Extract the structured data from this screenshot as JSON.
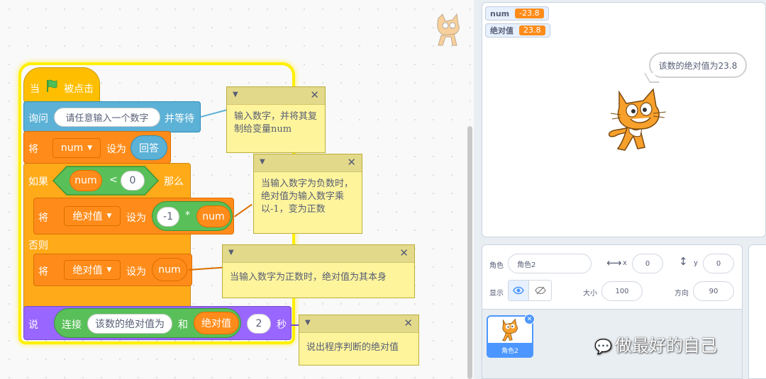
{
  "blocks": {
    "when_flag": {
      "when": "当",
      "clicked": "被点击"
    },
    "ask": {
      "ask": "询问",
      "prompt": "请任意输入一个数字",
      "wait": "并等待"
    },
    "set_num": {
      "set": "将",
      "var": "num",
      "to": "设为",
      "value": "回答"
    },
    "if": {
      "if": "如果",
      "var": "num",
      "op": "<",
      "value": "0",
      "then": "那么"
    },
    "set_abs_neg": {
      "set": "将",
      "var": "绝对值",
      "to": "设为",
      "left": "-1",
      "op": "*",
      "right": "num"
    },
    "else": {
      "label": "否则"
    },
    "set_abs_pos": {
      "set": "将",
      "var": "绝对值",
      "to": "设为",
      "value": "num"
    },
    "say": {
      "say": "说",
      "join": "连接",
      "text": "该数的绝对值为",
      "and": "和",
      "var": "绝对值",
      "secs": "2",
      "unit": "秒"
    }
  },
  "comments": [
    {
      "text": "输入数字，并将其复制给变量num"
    },
    {
      "text": "当输入数字为负数时，绝对值为输入数字乘以-1，变为正数"
    },
    {
      "text": "当输入数字为正数时，绝对值为其本身"
    },
    {
      "text": "说出程序判断的绝对值"
    }
  ],
  "stage": {
    "monitors": [
      {
        "label": "num",
        "value": "-23.8"
      },
      {
        "label": "绝对值",
        "value": "23.8"
      }
    ],
    "speech": "该数的绝对值为23.8"
  },
  "sprite_info": {
    "sprite_label": "角色",
    "sprite_name": "角色2",
    "x_label": "x",
    "x": "0",
    "y_label": "y",
    "y": "0",
    "show_label": "显示",
    "size_label": "大小",
    "size": "100",
    "direction_label": "方向",
    "direction": "90"
  },
  "sprite_list": [
    {
      "name": "角色2"
    }
  ],
  "watermark": "做最好的自己",
  "colors": {
    "events": "#ffbf00",
    "sensing": "#5cb1d6",
    "variables": "#ff8c1a",
    "control": "#ffab19",
    "looks": "#9966ff",
    "operators": "#59c059",
    "glow": "#ffef00",
    "comment": "#fef49c"
  }
}
